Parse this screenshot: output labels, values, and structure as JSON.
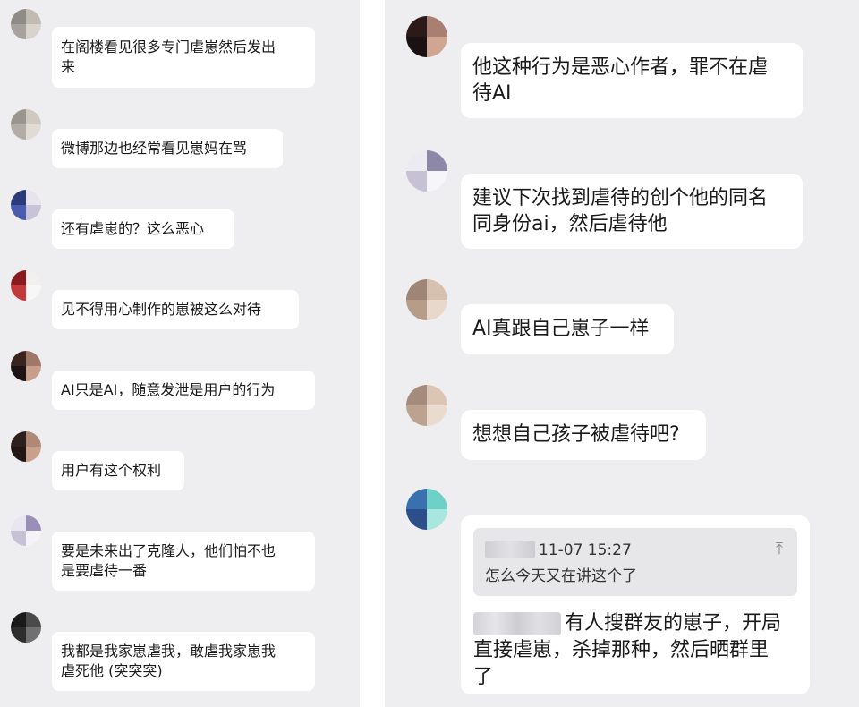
{
  "left_panel": {
    "messages": [
      {
        "text": "在阁楼看见很多专门虐崽然后发出\n来",
        "avatar_colors": [
          "#8f8b86",
          "#c2bbb4",
          "#a7a29d",
          "#d8d3cd"
        ]
      },
      {
        "text": "微博那边也经常看见崽妈在骂",
        "avatar_colors": [
          "#9a958e",
          "#cfc9c1",
          "#b2ada6",
          "#e0dbd4"
        ]
      },
      {
        "text": "还有虐崽的？这么恶心",
        "avatar_colors": [
          "#2b3a7a",
          "#e8e4ee",
          "#4a5cb0",
          "#c9c3d8"
        ]
      },
      {
        "text": "见不得用心制作的崽被这么对待",
        "avatar_colors": [
          "#8b1a1f",
          "#f2f0ef",
          "#c23a3c",
          "#f7f7f7"
        ]
      },
      {
        "text": "AI只是AI，随意发泄是用户的行为",
        "avatar_colors": [
          "#3a2420",
          "#a07868",
          "#1c1414",
          "#c89f8a"
        ]
      },
      {
        "text": "用户有这个权利",
        "avatar_colors": [
          "#2e1e1c",
          "#b08878",
          "#231716",
          "#caa08c"
        ]
      },
      {
        "text": "要是未来出了克隆人，他们怕不也\n是要虐待一番",
        "avatar_colors": [
          "#e9e6f0",
          "#9a8fb8",
          "#c7c1d6",
          "#f5f3f8"
        ]
      },
      {
        "text": "我都是我家崽虐我，敢虐我家崽我\n虐死他 (突突突)",
        "avatar_colors": [
          "#1a1a1a",
          "#4a4a4a",
          "#2d2d2d",
          "#707070"
        ]
      }
    ]
  },
  "right_panel": {
    "messages": [
      {
        "text": "他这种行为是恶心作者，罪不在虐\n待AI",
        "avatar_colors": [
          "#2b1a18",
          "#a87f70",
          "#1a1212",
          "#d0a692"
        ]
      },
      {
        "text": "建议下次找到虐待的创个他的同名\n同身份ai，然后虐待他",
        "avatar_colors": [
          "#ecebf1",
          "#8d88a8",
          "#c6c2d4",
          "#f6f5f9"
        ]
      },
      {
        "text": "AI真跟自己崽子一样",
        "avatar_colors": [
          "#9e8576",
          "#d6c0b0",
          "#b79c8a",
          "#e8d8cc"
        ]
      },
      {
        "text": "想想自己孩子被虐待吧?",
        "avatar_colors": [
          "#a58b7c",
          "#dbc6b6",
          "#bda290",
          "#eadbcf"
        ]
      }
    ],
    "quote_message": {
      "avatar_colors": [
        "#3a6fb0",
        "#6fd0c8",
        "#2c4e8a",
        "#a9e6de"
      ],
      "quote": {
        "time": "11-07 15:27",
        "pin_icon": "↑-bar",
        "text": "怎么今天又在讲这个了"
      },
      "reply_line1": "有人搜群友的崽子，开局",
      "reply_line2": "直接虐崽，杀掉那种，然后晒群里",
      "reply_line3": "了"
    }
  }
}
